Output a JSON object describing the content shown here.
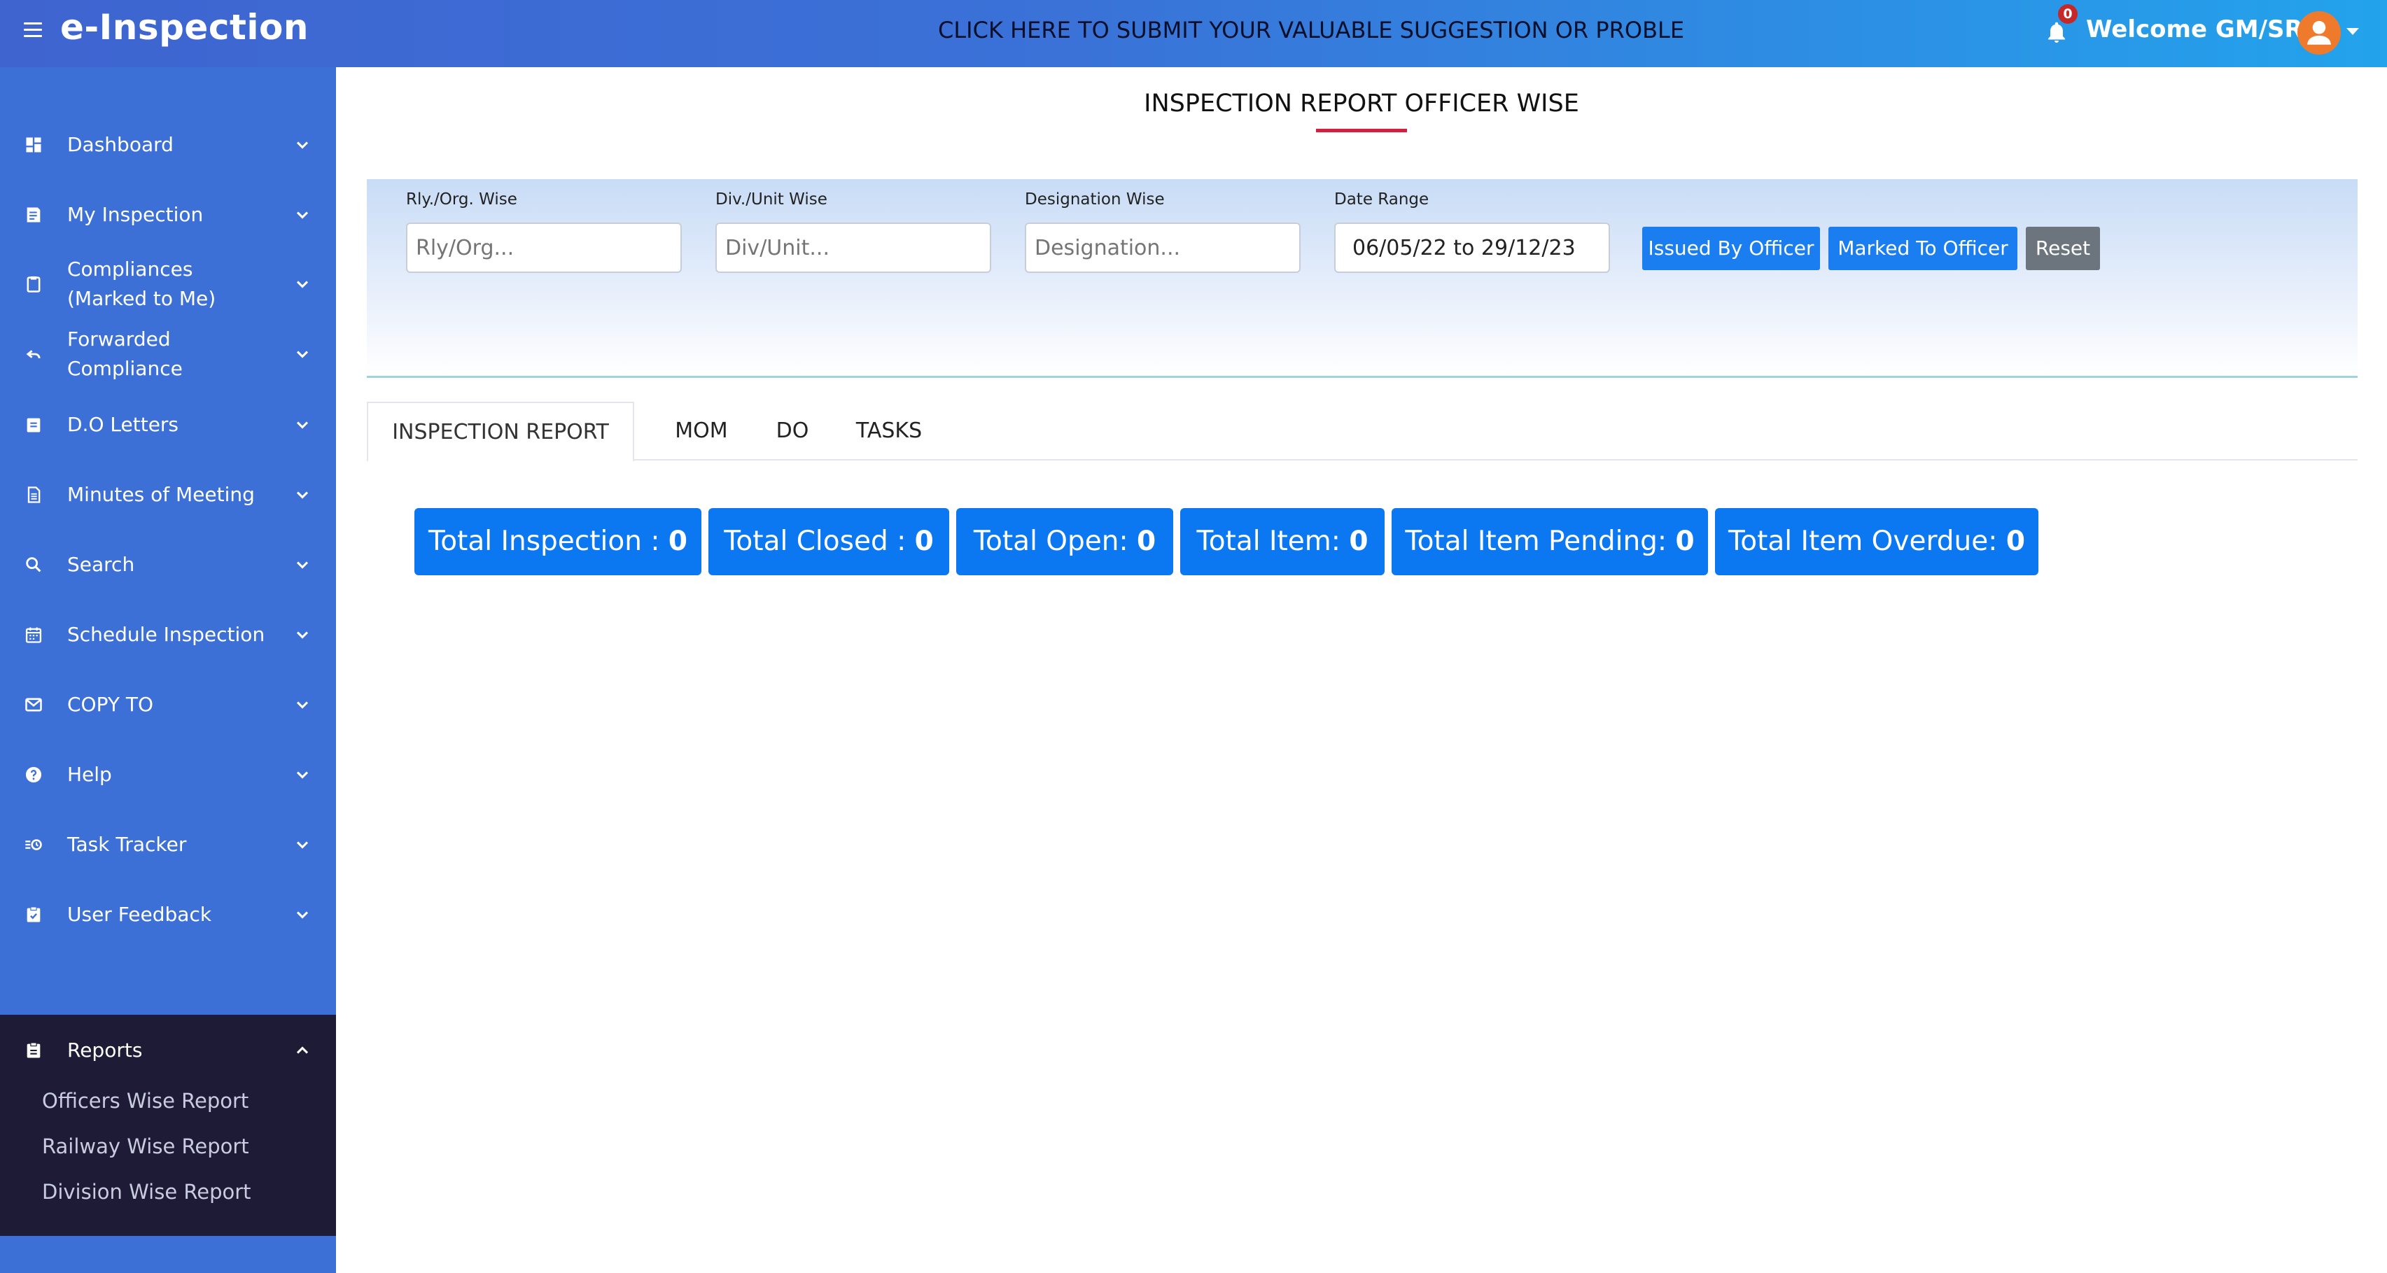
{
  "header": {
    "app_title": "e-Inspection",
    "marquee": "CLICK HERE TO SUBMIT YOUR VALUABLE SUGGESTION OR PROBLEM TI",
    "notification_count": "0",
    "welcome": "Welcome  GM/SR"
  },
  "sidebar": {
    "items": [
      {
        "label": "Dashboard",
        "icon": "dashboard-icon"
      },
      {
        "label": "My Inspection",
        "icon": "inspection-icon"
      },
      {
        "label": "Compliances (Marked to Me)",
        "icon": "clipboard-icon"
      },
      {
        "label": "Forwarded Compliance",
        "icon": "forward-icon"
      },
      {
        "label": "D.O Letters",
        "icon": "letter-icon"
      },
      {
        "label": "Minutes of Meeting",
        "icon": "document-icon"
      },
      {
        "label": "Search",
        "icon": "search-icon"
      },
      {
        "label": "Schedule Inspection",
        "icon": "calendar-icon"
      },
      {
        "label": "COPY TO",
        "icon": "mail-icon"
      },
      {
        "label": "Help",
        "icon": "help-icon"
      },
      {
        "label": "Task Tracker",
        "icon": "task-icon"
      },
      {
        "label": "User Feedback",
        "icon": "feedback-icon"
      }
    ],
    "reports": {
      "label": "Reports",
      "sub_items": [
        "Officers Wise Report",
        "Railway Wise Report",
        "Division Wise Report"
      ]
    }
  },
  "main": {
    "title": "INSPECTION REPORT OFFICER WISE",
    "filters": {
      "rly_label": "Rly./Org. Wise",
      "rly_placeholder": "Rly/Org...",
      "div_label": "Div./Unit Wise",
      "div_placeholder": "Div/Unit...",
      "designation_label": "Designation Wise",
      "designation_placeholder": "Designation...",
      "date_label": "Date Range",
      "date_value": "06/05/22 to 29/12/23",
      "issued_btn": "Issued By Officer",
      "marked_btn": "Marked To Officer",
      "reset_btn": "Reset"
    },
    "tabs": [
      "INSPECTION REPORT",
      "MOM",
      "DO",
      "TASKS"
    ],
    "stats": [
      {
        "label": "Total Inspection : ",
        "value": "0"
      },
      {
        "label": "Total Closed : ",
        "value": "0"
      },
      {
        "label": "Total Open: ",
        "value": "0"
      },
      {
        "label": "Total Item: ",
        "value": "0"
      },
      {
        "label": "Total Item Pending: ",
        "value": "0"
      },
      {
        "label": "Total Item Overdue: ",
        "value": "0"
      }
    ]
  },
  "colors": {
    "sidebar": "#3d70d6",
    "reports_block": "#1d1b36",
    "primary_button": "#1a7ef0",
    "accent_underline": "#d3203e"
  }
}
